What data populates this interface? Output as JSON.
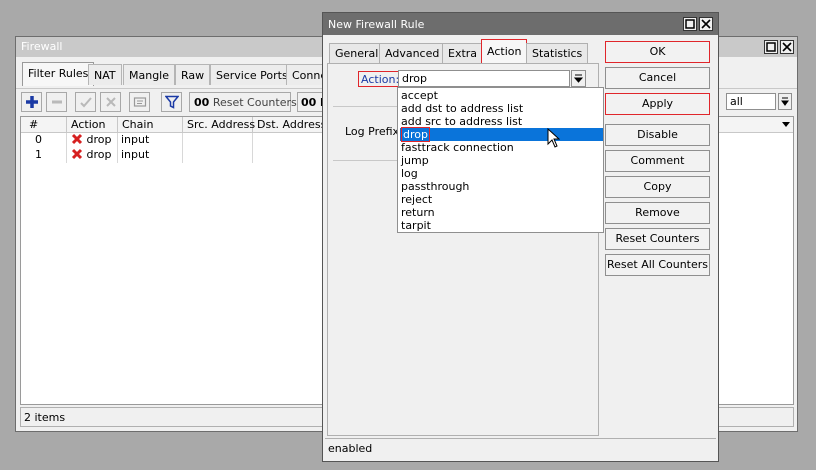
{
  "firewall": {
    "title": "Firewall",
    "tabs": [
      "Filter Rules",
      "NAT",
      "Mangle",
      "Raw",
      "Service Ports",
      "Conne"
    ],
    "toolbar": {
      "counter_prefix": "00",
      "reset_counters": "Reset Counters",
      "counter_prefix2": "00",
      "right_letter": "R",
      "filter_value": "all"
    },
    "columns": [
      "#",
      "Action",
      "Chain",
      "Src. Address",
      "Dst. Address"
    ],
    "rows": [
      {
        "num": "0",
        "action": "drop",
        "chain": "input"
      },
      {
        "num": "1",
        "action": "drop",
        "chain": "input"
      }
    ],
    "status": "2 items"
  },
  "dialog": {
    "title": "New Firewall Rule",
    "tabs": [
      "General",
      "Advanced",
      "Extra",
      "Action",
      "Statistics"
    ],
    "action_label": "Action:",
    "action_value": "drop",
    "log_prefix_label": "Log Prefix:",
    "dropdown_options": [
      "accept",
      "add dst to address list",
      "add src to address list",
      "drop",
      "fasttrack connection",
      "jump",
      "log",
      "passthrough",
      "reject",
      "return",
      "tarpit"
    ],
    "selected_option": "drop",
    "buttons": [
      "OK",
      "Cancel",
      "Apply",
      "Disable",
      "Comment",
      "Copy",
      "Remove",
      "Reset Counters",
      "Reset All Counters"
    ],
    "status": "enabled"
  },
  "colors": {
    "highlight": "#0a74da",
    "annotation_red": "#e0262b",
    "add_blue": "#1b3aa5",
    "drop_red": "#d62020"
  },
  "icons": [
    "add-icon",
    "remove-icon",
    "enable-icon",
    "disable-icon",
    "comment-icon",
    "filter-icon",
    "drop-x-icon",
    "dropdown-arrow-icon",
    "maximize-icon",
    "close-icon",
    "mouse-cursor-icon"
  ]
}
